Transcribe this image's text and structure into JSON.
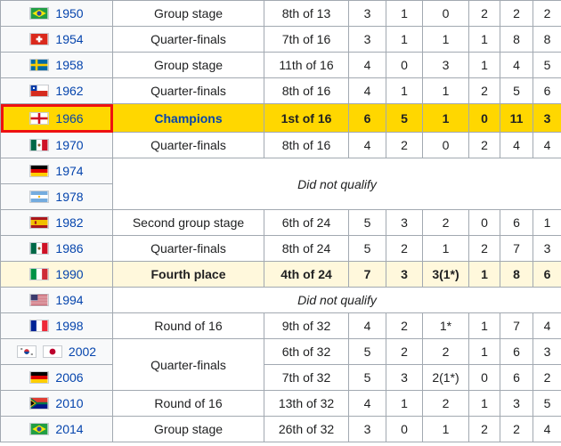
{
  "rows": [
    {
      "year": "1950",
      "flag": "brazil-flag-icon",
      "round": "Group stage",
      "position": "8th of 13",
      "gp": "3",
      "w": "1",
      "d": "0",
      "l": "2",
      "gf": "2",
      "ga": "2"
    },
    {
      "year": "1954",
      "flag": "switzerland-flag-icon",
      "round": "Quarter-finals",
      "position": "7th of 16",
      "gp": "3",
      "w": "1",
      "d": "1",
      "l": "1",
      "gf": "8",
      "ga": "8"
    },
    {
      "year": "1958",
      "flag": "sweden-flag-icon",
      "round": "Group stage",
      "position": "11th of 16",
      "gp": "4",
      "w": "0",
      "d": "3",
      "l": "1",
      "gf": "4",
      "ga": "5"
    },
    {
      "year": "1962",
      "flag": "chile-flag-icon",
      "round": "Quarter-finals",
      "position": "8th of 16",
      "gp": "4",
      "w": "1",
      "d": "1",
      "l": "2",
      "gf": "5",
      "ga": "6"
    },
    {
      "year": "1966",
      "flag": "england-flag-icon",
      "round": "Champions",
      "position": "1st of 16",
      "gp": "6",
      "w": "5",
      "d": "1",
      "l": "0",
      "gf": "11",
      "ga": "3"
    },
    {
      "year": "1970",
      "flag": "mexico-flag-icon",
      "round": "Quarter-finals",
      "position": "8th of 16",
      "gp": "4",
      "w": "2",
      "d": "0",
      "l": "2",
      "gf": "4",
      "ga": "4"
    },
    {
      "year": "1974",
      "flag": "germany-flag-icon"
    },
    {
      "year": "1978",
      "flag": "argentina-flag-icon"
    },
    {
      "year": "1982",
      "flag": "spain-flag-icon",
      "round": "Second group stage",
      "position": "6th of 24",
      "gp": "5",
      "w": "3",
      "d": "2",
      "l": "0",
      "gf": "6",
      "ga": "1"
    },
    {
      "year": "1986",
      "flag": "mexico-flag-icon",
      "round": "Quarter-finals",
      "position": "8th of 24",
      "gp": "5",
      "w": "2",
      "d": "1",
      "l": "2",
      "gf": "7",
      "ga": "3"
    },
    {
      "year": "1990",
      "flag": "italy-flag-icon",
      "round": "Fourth place",
      "position": "4th of 24",
      "gp": "7",
      "w": "3",
      "d": "3(1*)",
      "l": "1",
      "gf": "8",
      "ga": "6"
    },
    {
      "year": "1994",
      "flag": "usa-flag-icon"
    },
    {
      "year": "1998",
      "flag": "france-flag-icon",
      "round": "Round of 16",
      "position": "9th of 32",
      "gp": "4",
      "w": "2",
      "d": "1*",
      "l": "1",
      "gf": "7",
      "ga": "4"
    },
    {
      "year": "2002",
      "flag": "korea-japan-flag-icon",
      "position": "6th of 32",
      "gp": "5",
      "w": "2",
      "d": "2",
      "l": "1",
      "gf": "6",
      "ga": "3"
    },
    {
      "year": "2006",
      "flag": "germany-flag-icon",
      "position": "7th of 32",
      "gp": "5",
      "w": "3",
      "d": "2(1*)",
      "l": "0",
      "gf": "6",
      "ga": "2"
    },
    {
      "year": "2010",
      "flag": "south-africa-flag-icon",
      "round": "Round of 16",
      "position": "13th of 32",
      "gp": "4",
      "w": "1",
      "d": "2",
      "l": "1",
      "gf": "3",
      "ga": "5"
    },
    {
      "year": "2014",
      "flag": "brazil-flag-icon",
      "round": "Group stage",
      "position": "26th of 32",
      "gp": "3",
      "w": "0",
      "d": "1",
      "l": "2",
      "gf": "2",
      "ga": "4"
    }
  ],
  "dnq_1974_1978": "Did not qualify",
  "dnq_1994": "Did not qualify",
  "round_2002_2006": "Quarter-finals"
}
